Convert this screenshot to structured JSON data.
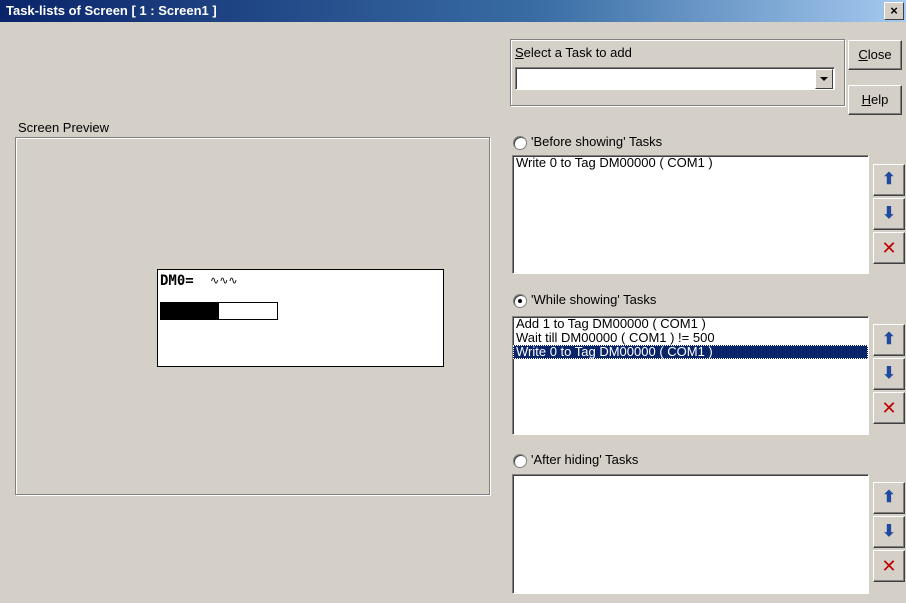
{
  "window": {
    "title": "Task-lists of Screen [ 1 : Screen1 ]",
    "close_glyph": "×"
  },
  "select_task": {
    "label": "Select a Task to add",
    "value": ""
  },
  "buttons": {
    "close": "Close",
    "help": "Help"
  },
  "preview": {
    "label": "Screen Preview",
    "tag_text": "DM0=",
    "tag_value": "∿∿∿",
    "bar_fill": 0.5
  },
  "before_showing": {
    "label": "'Before showing' Tasks",
    "selected": false,
    "items": [
      "Write 0 to Tag DM00000 ( COM1 )"
    ]
  },
  "while_showing": {
    "label": "'While showing' Tasks",
    "selected": true,
    "items": [
      "Add 1 to Tag DM00000 ( COM1 )",
      "Wait till DM00000 ( COM1 ) != 500",
      "Write 0 to Tag DM00000 ( COM1 )"
    ],
    "selected_index": 2
  },
  "after_hiding": {
    "label": "'After hiding' Tasks",
    "selected": false,
    "items": []
  },
  "icons": {
    "up": "arrow-up-icon",
    "down": "arrow-down-icon",
    "delete": "delete-icon"
  }
}
